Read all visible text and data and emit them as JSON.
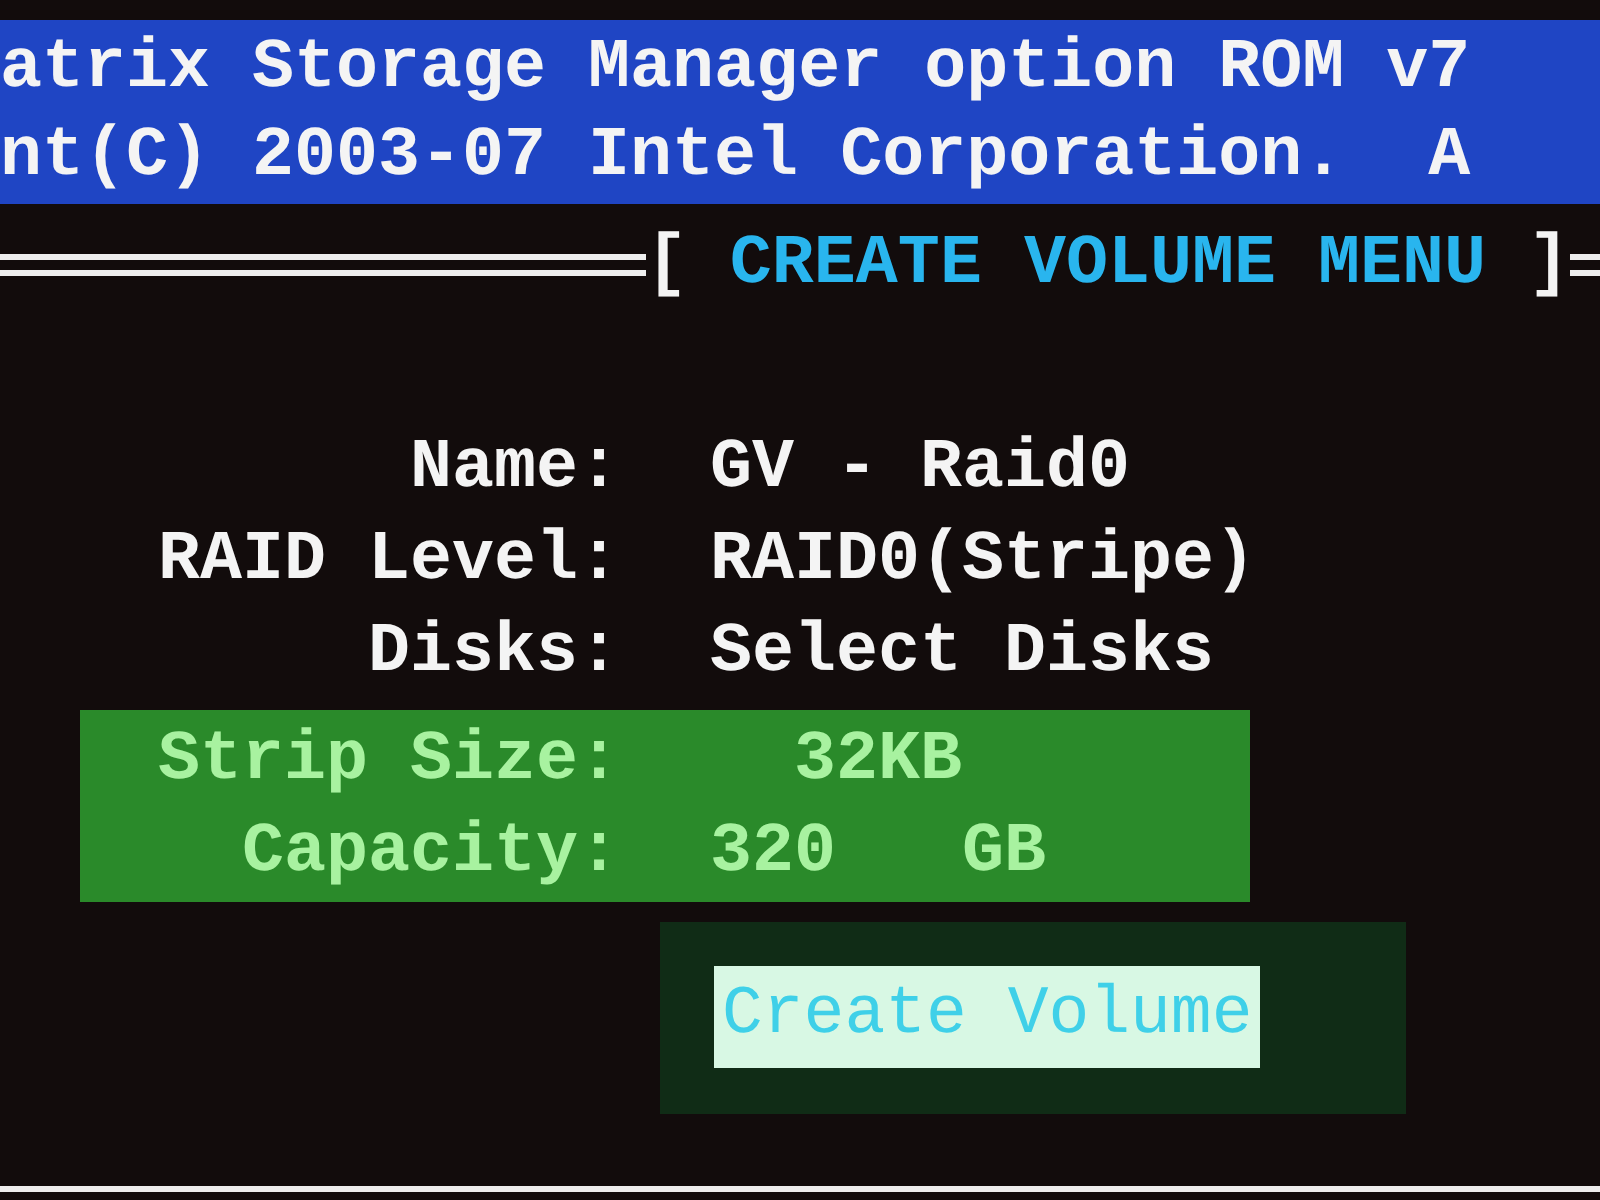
{
  "header": {
    "lines": [
      "atrix Storage Manager option ROM v7",
      "nt(C) 2003-07 Intel Corporation.  A"
    ]
  },
  "menu_title": {
    "left_bracket": "[",
    "title": "CREATE VOLUME MENU",
    "right_bracket": "]"
  },
  "fields": [
    {
      "label": "Name:",
      "value": "GV - Raid0"
    },
    {
      "label": "RAID Level:",
      "value": "RAID0(Stripe)"
    },
    {
      "label": "Disks:",
      "value": "Select Disks"
    }
  ],
  "info_fields": [
    {
      "label": "Strip Size:",
      "value": "  32KB"
    },
    {
      "label": "Capacity:",
      "value": "320   GB"
    }
  ],
  "button": {
    "label": "Create Volume",
    "selected": true
  }
}
